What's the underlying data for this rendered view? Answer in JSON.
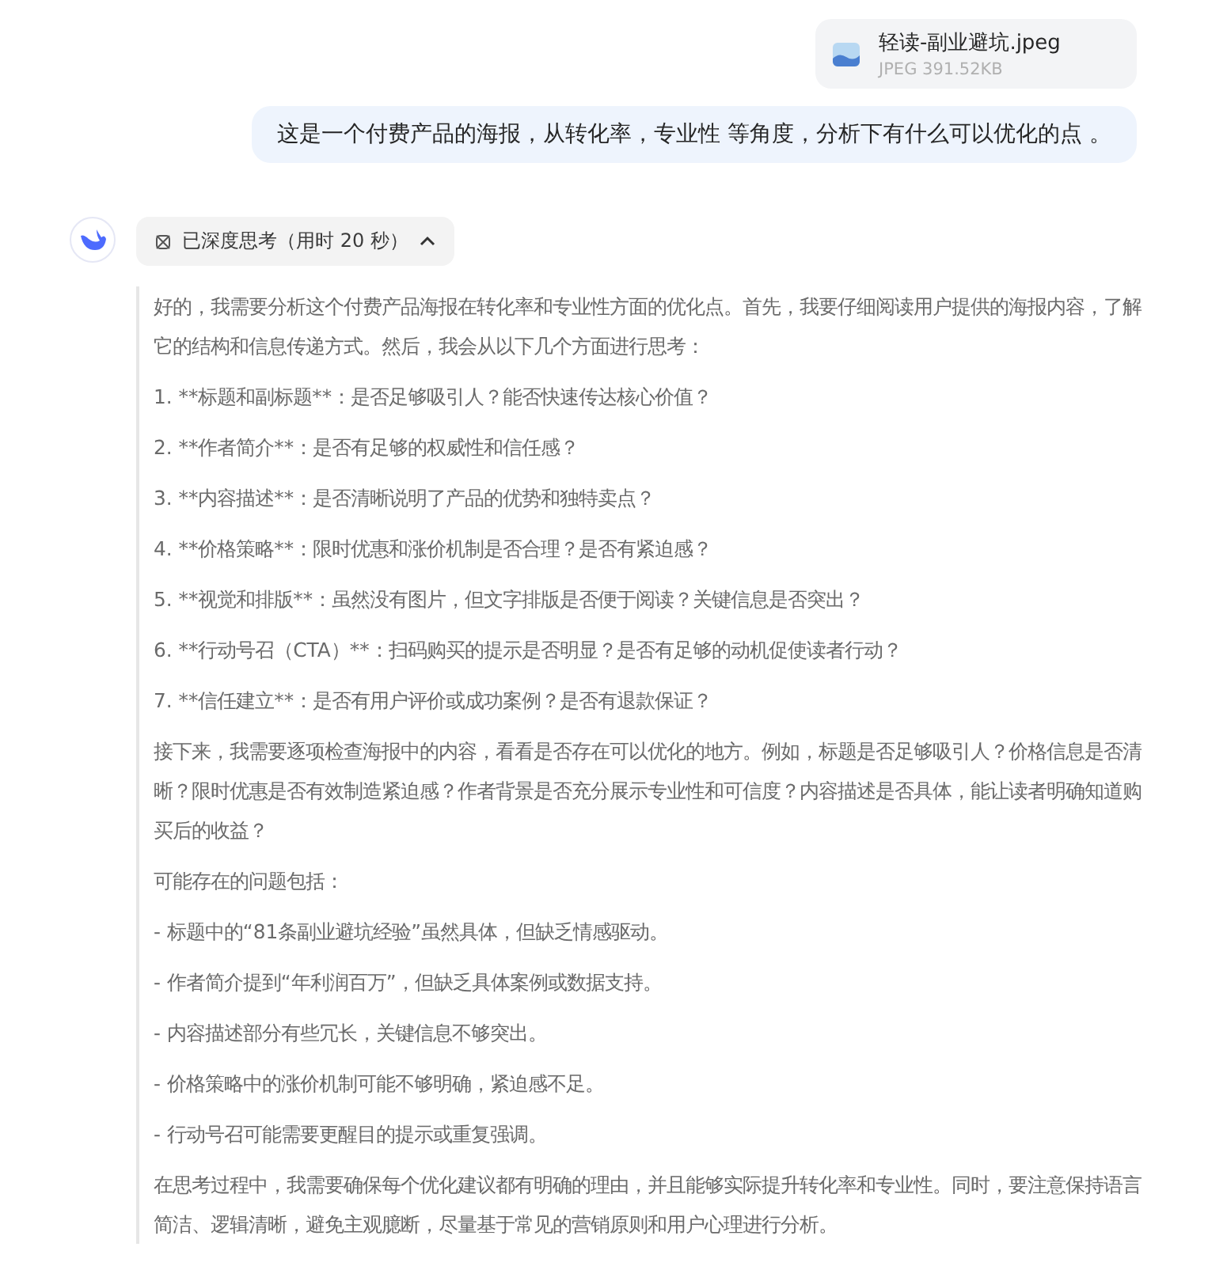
{
  "attachment": {
    "name": "轻读-副业避坑.jpeg",
    "meta": "JPEG 391.52KB"
  },
  "user_message": "这是一个付费产品的海报，从转化率，专业性 等角度，分析下有什么可以优化的点 。",
  "thinking": {
    "label": "已深度思考（用时 20 秒）",
    "expanded": true,
    "paragraphs": [
      "好的，我需要分析这个付费产品海报在转化率和专业性方面的优化点。首先，我要仔细阅读用户提供的海报内容，了解它的结构和信息传递方式。然后，我会从以下几个方面进行思考：",
      "1. **标题和副标题**：是否足够吸引人？能否快速传达核心价值？",
      "2. **作者简介**：是否有足够的权威性和信任感？",
      "3. **内容描述**：是否清晰说明了产品的优势和独特卖点？",
      "4. **价格策略**：限时优惠和涨价机制是否合理？是否有紧迫感？",
      "5. **视觉和排版**：虽然没有图片，但文字排版是否便于阅读？关键信息是否突出？",
      "6. **行动号召（CTA）**：扫码购买的提示是否明显？是否有足够的动机促使读者行动？",
      "7. **信任建立**：是否有用户评价或成功案例？是否有退款保证？",
      "接下来，我需要逐项检查海报中的内容，看看是否存在可以优化的地方。例如，标题是否足够吸引人？价格信息是否清晰？限时优惠是否有效制造紧迫感？作者背景是否充分展示专业性和可信度？内容描述是否具体，能让读者明确知道购买后的收益？",
      "可能存在的问题包括：",
      "- 标题中的“81条副业避坑经验”虽然具体，但缺乏情感驱动。",
      "- 作者简介提到“年利润百万”，但缺乏具体案例或数据支持。",
      "- 内容描述部分有些冗长，关键信息不够突出。",
      "- 价格策略中的涨价机制可能不够明确，紧迫感不足。",
      "- 行动号召可能需要更醒目的提示或重复强调。",
      "在思考过程中，我需要确保每个优化建议都有明确的理由，并且能够实际提升转化率和专业性。同时，要注意保持语言简洁、逻辑清晰，避免主观臆断，尽量基于常见的营销原则和用户心理进行分析。"
    ]
  }
}
